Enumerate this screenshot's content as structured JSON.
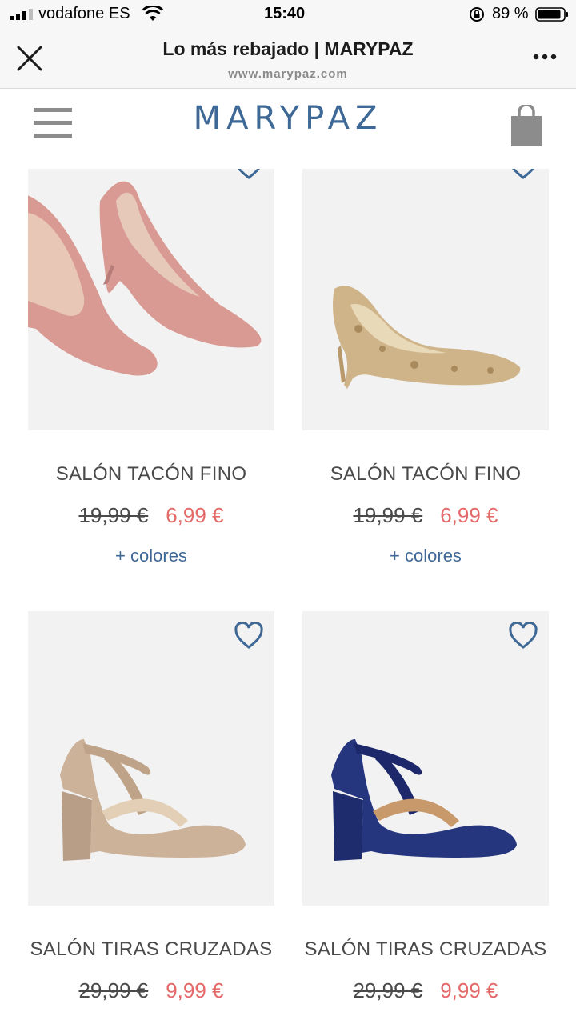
{
  "status_bar": {
    "carrier": "vodafone ES",
    "time": "15:40",
    "battery": "89 %"
  },
  "browser": {
    "title": "Lo más rebajado | MARYPAZ",
    "url": "www.marypaz.com"
  },
  "site": {
    "logo": "MARYPAZ"
  },
  "products": [
    {
      "name": "SALÓN TACÓN FINO",
      "old_price": "19,99 €",
      "new_price": "6,99 €",
      "colors_link": "+ colores",
      "color": "#d99a93"
    },
    {
      "name": "SALÓN TACÓN FINO",
      "old_price": "19,99 €",
      "new_price": "6,99 €",
      "colors_link": "+ colores",
      "color": "#cfb48a"
    },
    {
      "name": "SALÓN TIRAS CRUZADAS",
      "old_price": "29,99 €",
      "new_price": "9,99 €",
      "color": "#cdb29a"
    },
    {
      "name": "SALÓN TIRAS CRUZADAS",
      "old_price": "29,99 €",
      "new_price": "9,99 €",
      "color": "#25357e"
    }
  ],
  "colors": {
    "brand": "#3e6896",
    "sale_price": "#e46a6a",
    "image_bg": "#f2f2f2"
  }
}
